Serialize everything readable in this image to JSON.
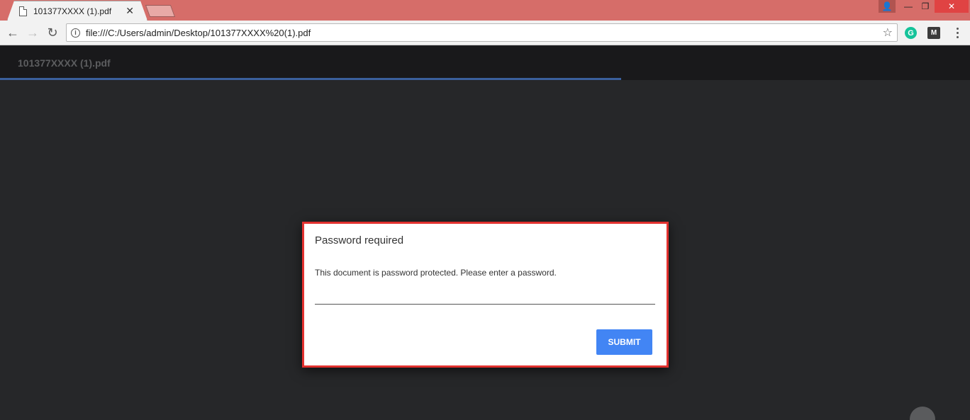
{
  "browser": {
    "tab_title": "101377XXXX (1).pdf",
    "tab_close": "✕",
    "url": "file:///C:/Users/admin/Desktop/101377XXXX%20(1).pdf",
    "back_icon": "←",
    "forward_icon": "→",
    "reload_icon": "↻",
    "info_icon": "i",
    "star_icon": "☆",
    "extension_g": "G",
    "extension_m": "M",
    "window_user_icon": "👤",
    "window_min": "—",
    "window_max": "❐",
    "window_close": "✕"
  },
  "viewer": {
    "document_title": "101377XXXX (1).pdf",
    "load_progress": 0.64
  },
  "dialog": {
    "title": "Password required",
    "message": "This document is password protected. Please enter a password.",
    "password_value": "",
    "submit_label": "SUBMIT"
  },
  "colors": {
    "titlebar": "#d66d69",
    "viewer_bg": "#262729",
    "dialog_border": "#e2312f",
    "submit_button": "#4285f4"
  }
}
